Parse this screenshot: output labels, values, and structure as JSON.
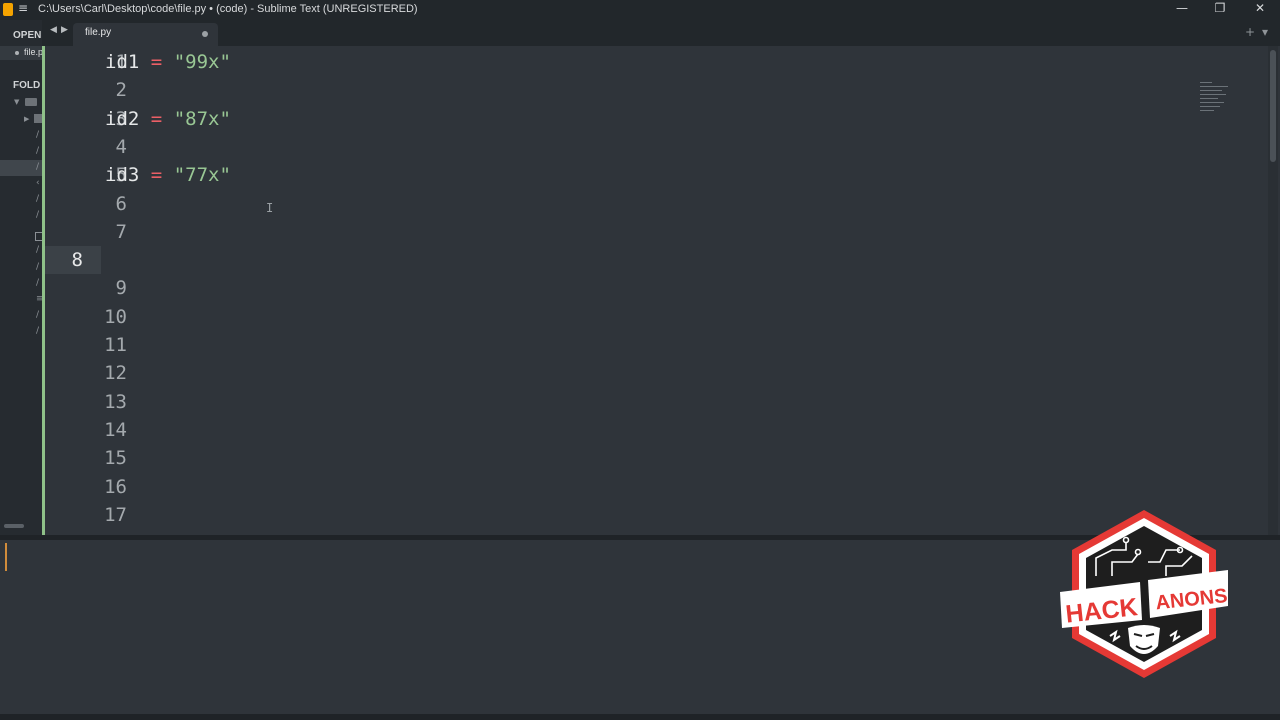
{
  "window": {
    "title": "C:\\Users\\Carl\\Desktop\\code\\file.py • (code) - Sublime Text (UNREGISTERED)",
    "controls": {
      "minimize": "—",
      "restore": "❐",
      "close": "✕"
    },
    "menu_icon": "≡"
  },
  "sidebar": {
    "open_files_header": "OPEN",
    "open_file": "file.py",
    "folders_header": "FOLD"
  },
  "tabs": [
    {
      "label": "file.py",
      "modified": true
    }
  ],
  "tabbar": {
    "add": "+",
    "dropdown": "▾"
  },
  "editor": {
    "language": "python",
    "current_line": 8,
    "line_numbers": [
      "1",
      "2",
      "3",
      "4",
      "5",
      "6",
      "7",
      "8",
      "9",
      "10",
      "11",
      "12",
      "13",
      "14",
      "15",
      "16",
      "17"
    ],
    "lines": [
      {
        "num": 1,
        "var": "id1",
        "op": "=",
        "value": "\"99x\""
      },
      {
        "num": 3,
        "var": "id2",
        "op": "=",
        "value": "\"87x\""
      },
      {
        "num": 5,
        "var": "id3",
        "op": "=",
        "value": "\"77x\""
      }
    ]
  },
  "colors": {
    "background": "#2f343a",
    "chrome": "#22272b",
    "string": "#99c794",
    "operator": "#ec5f66",
    "identifier": "#e6e8e9",
    "line_number": "#a4a9ad",
    "modified_gutter": "#8fc189",
    "console_caret": "#d18c3b"
  },
  "overlay": {
    "logo_left": "HACK",
    "logo_right": "ANONS",
    "logo_colors": {
      "red": "#e53935",
      "white": "#ffffff",
      "dark": "#1e1e1e"
    }
  },
  "icons": {
    "app": "sublime-text-icon",
    "menu": "hamburger-icon",
    "nav_back": "chevron-left-icon",
    "nav_forward": "chevron-right-icon",
    "tab_dirty": "unsaved-dot-icon"
  }
}
